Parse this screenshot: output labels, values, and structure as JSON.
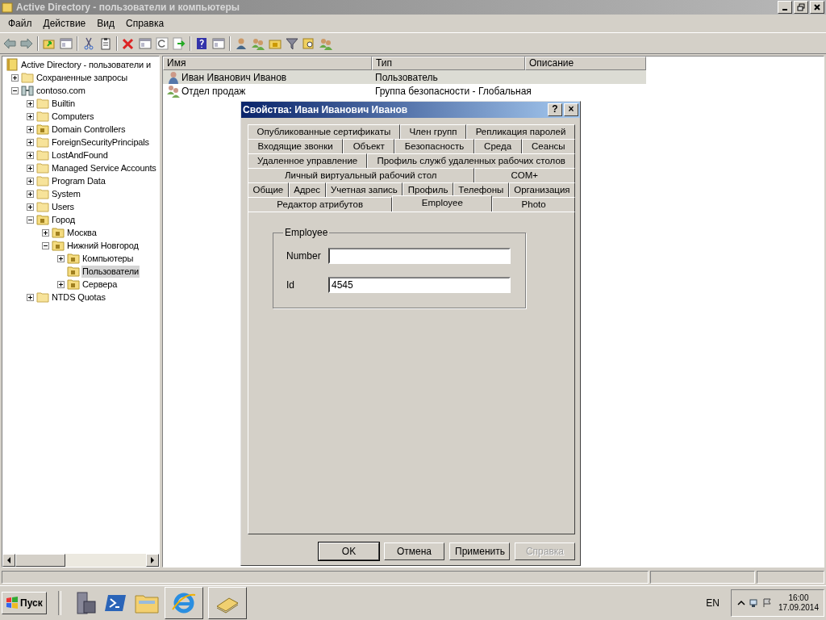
{
  "window": {
    "title": "Active Directory - пользователи и компьютеры"
  },
  "menu": [
    "Файл",
    "Действие",
    "Вид",
    "Справка"
  ],
  "tree": [
    {
      "label": "Active Directory - пользователи и",
      "kind": "root",
      "selected": false,
      "children": [
        {
          "label": "Сохраненные запросы",
          "kind": "folder",
          "expanded": false,
          "selected": false
        },
        {
          "label": "contoso.com",
          "kind": "domain",
          "expanded": true,
          "selected": false,
          "children": [
            {
              "label": "Builtin",
              "kind": "folder",
              "expanded": false,
              "selected": false
            },
            {
              "label": "Computers",
              "kind": "folder",
              "expanded": false,
              "selected": false
            },
            {
              "label": "Domain Controllers",
              "kind": "ou",
              "expanded": false,
              "selected": false
            },
            {
              "label": "ForeignSecurityPrincipals",
              "kind": "folder",
              "expanded": false,
              "selected": false
            },
            {
              "label": "LostAndFound",
              "kind": "folder",
              "expanded": false,
              "selected": false
            },
            {
              "label": "Managed Service Accounts",
              "kind": "folder",
              "expanded": false,
              "selected": false
            },
            {
              "label": "Program Data",
              "kind": "folder",
              "expanded": false,
              "selected": false
            },
            {
              "label": "System",
              "kind": "folder",
              "expanded": false,
              "selected": false
            },
            {
              "label": "Users",
              "kind": "folder",
              "expanded": false,
              "selected": false
            },
            {
              "label": "Город",
              "kind": "ou",
              "expanded": true,
              "selected": false,
              "children": [
                {
                  "label": "Москва",
                  "kind": "ou",
                  "expanded": false,
                  "selected": false
                },
                {
                  "label": "Нижний Новгород",
                  "kind": "ou",
                  "expanded": true,
                  "selected": false,
                  "children": [
                    {
                      "label": "Компьютеры",
                      "kind": "ou",
                      "expanded": false,
                      "selected": false
                    },
                    {
                      "label": "Пользователи",
                      "kind": "ou",
                      "selected": true
                    },
                    {
                      "label": "Сервера",
                      "kind": "ou",
                      "expanded": false,
                      "selected": false
                    }
                  ]
                }
              ]
            },
            {
              "label": "NTDS Quotas",
              "kind": "folder",
              "expanded": false,
              "selected": false
            }
          ]
        }
      ]
    }
  ],
  "table": {
    "columns": [
      "Имя",
      "Тип",
      "Описание"
    ],
    "rows": [
      {
        "kind": "user",
        "name": "Иван Иванович Иванов",
        "type": "Пользователь",
        "selected": true
      },
      {
        "kind": "group",
        "name": "Отдел продаж",
        "type": "Группа безопасности - Глобальная",
        "selected": false
      }
    ]
  },
  "dialog": {
    "title": "Свойства: Иван Иванович Иванов",
    "help": "?",
    "close": "×",
    "tab_rows": [
      [
        {
          "label": "Опубликованные сертификаты",
          "selected": false
        },
        {
          "label": "Член групп",
          "selected": false
        },
        {
          "label": "Репликация паролей",
          "selected": false
        }
      ],
      [
        {
          "label": "Входящие звонки",
          "selected": false
        },
        {
          "label": "Объект",
          "selected": false
        },
        {
          "label": "Безопасность",
          "selected": false
        },
        {
          "label": "Среда",
          "selected": false
        },
        {
          "label": "Сеансы",
          "selected": false
        }
      ],
      [
        {
          "label": "Удаленное управление",
          "selected": false
        },
        {
          "label": "Профиль служб удаленных рабочих столов",
          "selected": false
        }
      ],
      [
        {
          "label": "Личный виртуальный рабочий стол",
          "selected": false
        },
        {
          "label": "COM+",
          "selected": false
        }
      ],
      [
        {
          "label": "Общие",
          "selected": false
        },
        {
          "label": "Адрес",
          "selected": false
        },
        {
          "label": "Учетная запись",
          "selected": false
        },
        {
          "label": "Профиль",
          "selected": false
        },
        {
          "label": "Телефоны",
          "selected": false
        },
        {
          "label": "Организация",
          "selected": false
        }
      ],
      [
        {
          "label": "Редактор атрибутов",
          "selected": false
        },
        {
          "label": "Employee",
          "selected": true
        },
        {
          "label": "Photo",
          "selected": false
        }
      ]
    ],
    "group": {
      "title": "Employee",
      "fields": [
        {
          "label": "Number"
        },
        {
          "label": "Id",
          "value": "4545"
        }
      ]
    },
    "buttons": [
      {
        "label": "OK",
        "disabled": false,
        "default": true
      },
      {
        "label": "Отмена",
        "disabled": false,
        "default": false
      },
      {
        "label": "Применить",
        "disabled": false,
        "default": false
      },
      {
        "label": "Справка",
        "disabled": true,
        "default": false
      }
    ]
  },
  "taskbar": {
    "start": "Пуск",
    "language": "EN",
    "time": "16:00",
    "date": "17.09.2014"
  }
}
